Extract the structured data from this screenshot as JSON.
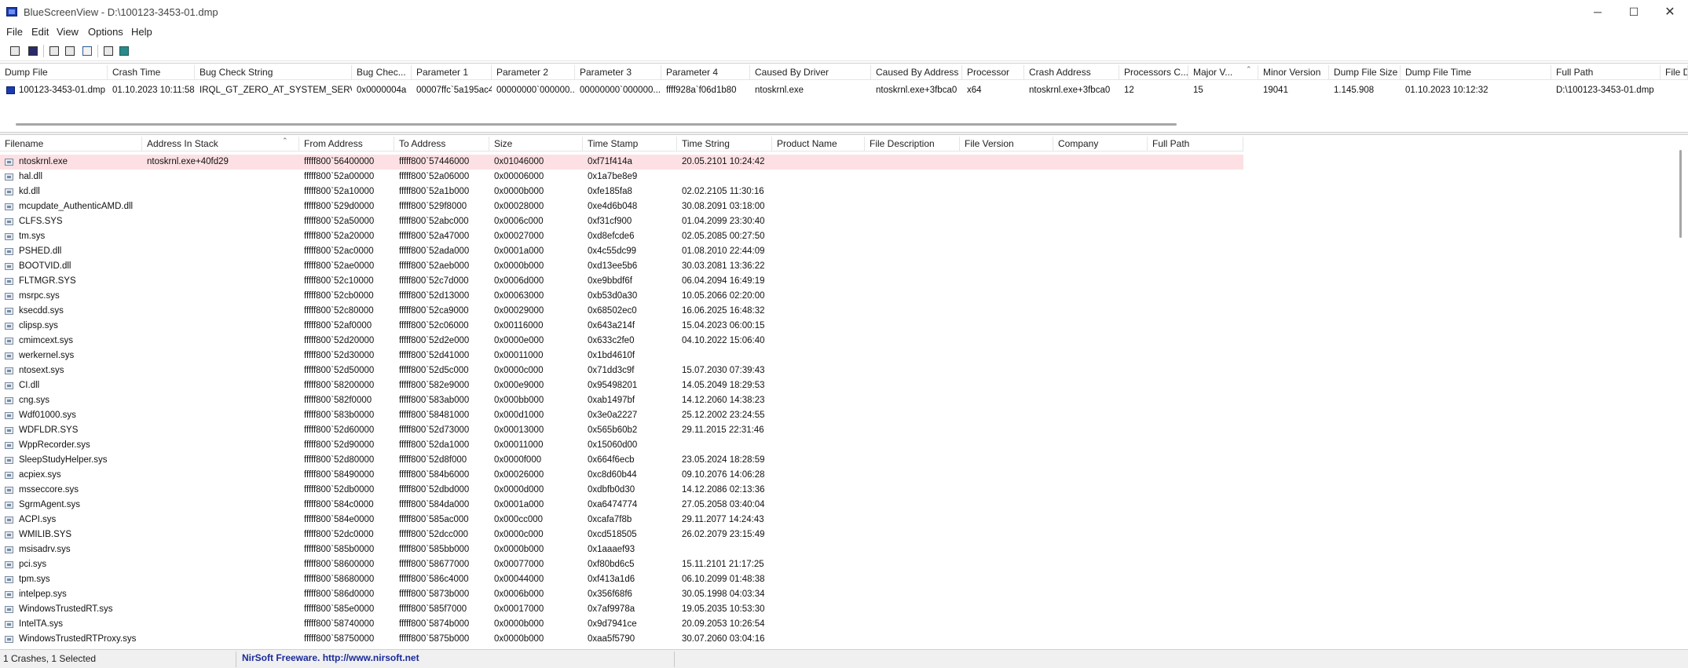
{
  "window": {
    "title": "BlueScreenView  -  D:\\100123-3453-01.dmp",
    "minimize_glyph": "─",
    "maximize_glyph": "☐",
    "close_glyph": "✕"
  },
  "menu": [
    "File",
    "Edit",
    "View",
    "Options",
    "Help"
  ],
  "toolbar": {
    "icons": [
      "properties-icon",
      "save-icon",
      "copy-icon",
      "copy-multi-icon",
      "html-report-icon",
      "find-icon",
      "exit-icon"
    ]
  },
  "crash_table": {
    "headers": [
      "Dump File",
      "Crash Time",
      "Bug Check String",
      "Bug Chec...",
      "Parameter 1",
      "Parameter 2",
      "Parameter 3",
      "Parameter 4",
      "Caused By Driver",
      "Caused By Address",
      "Processor",
      "Crash Address",
      "Processors C...",
      "Major V...",
      "Minor Version",
      "Dump File Size",
      "Dump File Time",
      "Full Path",
      "File De"
    ],
    "sort_indicator": "⌃",
    "rows": [
      [
        "100123-3453-01.dmp",
        "01.10.2023 10:11:58",
        "IRQL_GT_ZERO_AT_SYSTEM_SERVICE",
        "0x0000004a",
        "00007ffc`5a195ac4",
        "00000000`000000...",
        "00000000`000000...",
        "ffff928a`f06d1b80",
        "ntoskrnl.exe",
        "ntoskrnl.exe+3fbca0",
        "x64",
        "ntoskrnl.exe+3fbca0",
        "12",
        "15",
        "19041",
        "1.145.908",
        "01.10.2023 10:12:32",
        "D:\\100123-3453-01.dmp",
        ""
      ]
    ]
  },
  "driver_table": {
    "headers": [
      "Filename",
      "Address In Stack",
      "From Address",
      "To Address",
      "Size",
      "Time Stamp",
      "Time String",
      "Product Name",
      "File Description",
      "File Version",
      "Company",
      "Full Path"
    ],
    "sort_indicator": "⌃",
    "rows": [
      [
        "ntoskrnl.exe",
        "ntoskrnl.exe+40fd29",
        "fffff800`56400000",
        "fffff800`57446000",
        "0x01046000",
        "0xf71f414a",
        "20.05.2101 10:24:42"
      ],
      [
        "hal.dll",
        "",
        "fffff800`52a00000",
        "fffff800`52a06000",
        "0x00006000",
        "0x1a7be8e9",
        ""
      ],
      [
        "kd.dll",
        "",
        "fffff800`52a10000",
        "fffff800`52a1b000",
        "0x0000b000",
        "0xfe185fa8",
        "02.02.2105 11:30:16"
      ],
      [
        "mcupdate_AuthenticAMD.dll",
        "",
        "fffff800`529d0000",
        "fffff800`529f8000",
        "0x00028000",
        "0xe4d6b048",
        "30.08.2091 03:18:00"
      ],
      [
        "CLFS.SYS",
        "",
        "fffff800`52a50000",
        "fffff800`52abc000",
        "0x0006c000",
        "0xf31cf900",
        "01.04.2099 23:30:40"
      ],
      [
        "tm.sys",
        "",
        "fffff800`52a20000",
        "fffff800`52a47000",
        "0x00027000",
        "0xd8efcde6",
        "02.05.2085 00:27:50"
      ],
      [
        "PSHED.dll",
        "",
        "fffff800`52ac0000",
        "fffff800`52ada000",
        "0x0001a000",
        "0x4c55dc99",
        "01.08.2010 22:44:09"
      ],
      [
        "BOOTVID.dll",
        "",
        "fffff800`52ae0000",
        "fffff800`52aeb000",
        "0x0000b000",
        "0xd13ee5b6",
        "30.03.2081 13:36:22"
      ],
      [
        "FLTMGR.SYS",
        "",
        "fffff800`52c10000",
        "fffff800`52c7d000",
        "0x0006d000",
        "0xe9bbdf6f",
        "06.04.2094 16:49:19"
      ],
      [
        "msrpc.sys",
        "",
        "fffff800`52cb0000",
        "fffff800`52d13000",
        "0x00063000",
        "0xb53d0a30",
        "10.05.2066 02:20:00"
      ],
      [
        "ksecdd.sys",
        "",
        "fffff800`52c80000",
        "fffff800`52ca9000",
        "0x00029000",
        "0x68502ec0",
        "16.06.2025 16:48:32"
      ],
      [
        "clipsp.sys",
        "",
        "fffff800`52af0000",
        "fffff800`52c06000",
        "0x00116000",
        "0x643a214f",
        "15.04.2023 06:00:15"
      ],
      [
        "cmimcext.sys",
        "",
        "fffff800`52d20000",
        "fffff800`52d2e000",
        "0x0000e000",
        "0x633c2fe0",
        "04.10.2022 15:06:40"
      ],
      [
        "werkernel.sys",
        "",
        "fffff800`52d30000",
        "fffff800`52d41000",
        "0x00011000",
        "0x1bd4610f",
        ""
      ],
      [
        "ntosext.sys",
        "",
        "fffff800`52d50000",
        "fffff800`52d5c000",
        "0x0000c000",
        "0x71dd3c9f",
        "15.07.2030 07:39:43"
      ],
      [
        "CI.dll",
        "",
        "fffff800`58200000",
        "fffff800`582e9000",
        "0x000e9000",
        "0x95498201",
        "14.05.2049 18:29:53"
      ],
      [
        "cng.sys",
        "",
        "fffff800`582f0000",
        "fffff800`583ab000",
        "0x000bb000",
        "0xab1497bf",
        "14.12.2060 14:38:23"
      ],
      [
        "Wdf01000.sys",
        "",
        "fffff800`583b0000",
        "fffff800`58481000",
        "0x000d1000",
        "0x3e0a2227",
        "25.12.2002 23:24:55"
      ],
      [
        "WDFLDR.SYS",
        "",
        "fffff800`52d60000",
        "fffff800`52d73000",
        "0x00013000",
        "0x565b60b2",
        "29.11.2015 22:31:46"
      ],
      [
        "WppRecorder.sys",
        "",
        "fffff800`52d90000",
        "fffff800`52da1000",
        "0x00011000",
        "0x15060d00",
        ""
      ],
      [
        "SleepStudyHelper.sys",
        "",
        "fffff800`52d80000",
        "fffff800`52d8f000",
        "0x0000f000",
        "0x664f6ecb",
        "23.05.2024 18:28:59"
      ],
      [
        "acpiex.sys",
        "",
        "fffff800`58490000",
        "fffff800`584b6000",
        "0x00026000",
        "0xc8d60b44",
        "09.10.2076 14:06:28"
      ],
      [
        "msseccore.sys",
        "",
        "fffff800`52db0000",
        "fffff800`52dbd000",
        "0x0000d000",
        "0xdbfb0d30",
        "14.12.2086 02:13:36"
      ],
      [
        "SgrmAgent.sys",
        "",
        "fffff800`584c0000",
        "fffff800`584da000",
        "0x0001a000",
        "0xa6474774",
        "27.05.2058 03:40:04"
      ],
      [
        "ACPI.sys",
        "",
        "fffff800`584e0000",
        "fffff800`585ac000",
        "0x000cc000",
        "0xcafa7f8b",
        "29.11.2077 14:24:43"
      ],
      [
        "WMILIB.SYS",
        "",
        "fffff800`52dc0000",
        "fffff800`52dcc000",
        "0x0000c000",
        "0xcd518505",
        "26.02.2079 23:15:49"
      ],
      [
        "msisadrv.sys",
        "",
        "fffff800`585b0000",
        "fffff800`585bb000",
        "0x0000b000",
        "0x1aaaef93",
        ""
      ],
      [
        "pci.sys",
        "",
        "fffff800`58600000",
        "fffff800`58677000",
        "0x00077000",
        "0xf80bd6c5",
        "15.11.2101 21:17:25"
      ],
      [
        "tpm.sys",
        "",
        "fffff800`58680000",
        "fffff800`586c4000",
        "0x00044000",
        "0xf413a1d6",
        "06.10.2099 01:48:38"
      ],
      [
        "intelpep.sys",
        "",
        "fffff800`586d0000",
        "fffff800`5873b000",
        "0x0006b000",
        "0x356f68f6",
        "30.05.1998 04:03:34"
      ],
      [
        "WindowsTrustedRT.sys",
        "",
        "fffff800`585e0000",
        "fffff800`585f7000",
        "0x00017000",
        "0x7af9978a",
        "19.05.2035 10:53:30"
      ],
      [
        "IntelTA.sys",
        "",
        "fffff800`58740000",
        "fffff800`5874b000",
        "0x0000b000",
        "0x9d7941ce",
        "20.09.2053 10:26:54"
      ],
      [
        "WindowsTrustedRTProxy.sys",
        "",
        "fffff800`58750000",
        "fffff800`5875b000",
        "0x0000b000",
        "0xaa5f5790",
        "30.07.2060 03:04:16"
      ]
    ]
  },
  "status": {
    "left": "1 Crashes, 1 Selected",
    "right": "NirSoft Freeware.  http://www.nirsoft.net"
  },
  "colors": {
    "highlight_row": "#fde0e4",
    "link": "#1a2a9a"
  }
}
